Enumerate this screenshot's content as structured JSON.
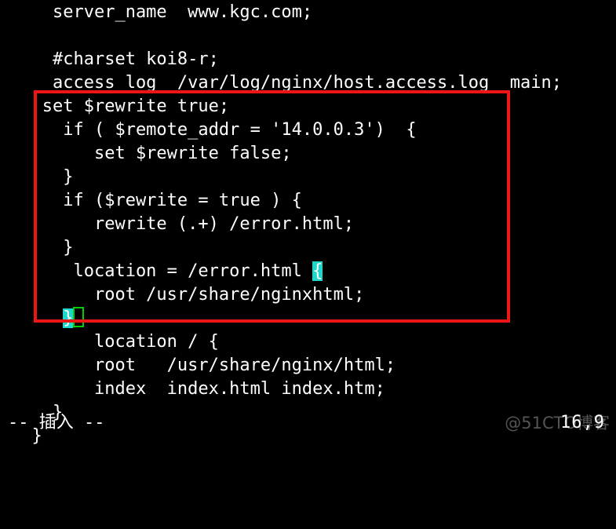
{
  "app": {
    "name": "vi-editor-terminal",
    "background_color": "#000000",
    "foreground_color": "#ffffff"
  },
  "colors": {
    "background": "#000000",
    "text": "#ffffff",
    "annotation_box": "#ee1515",
    "brace_match_highlight": "#1fd6cc",
    "cursor_outline": "#00d000",
    "watermark": "#9a9a9a"
  },
  "editor": {
    "lines": [
      {
        "text": "    server_name  www.kgc.com;",
        "id": "line-server-name"
      },
      {
        "text": "",
        "id": "line-blank-1"
      },
      {
        "text": "    #charset koi8-r;",
        "id": "line-charset"
      },
      {
        "text": "    access_log  /var/log/nginx/host.access.log  main;",
        "id": "line-access-log"
      },
      {
        "text": "   set $rewrite true;",
        "id": "line-set-rewrite-true"
      },
      {
        "text": "     if ( $remote_addr = '14.0.0.3')  {",
        "id": "line-if-remote-addr"
      },
      {
        "text": "        set $rewrite false;",
        "id": "line-set-rewrite-false"
      },
      {
        "text": "     }",
        "id": "line-close-if-1"
      },
      {
        "text": "     if ($rewrite = true ) {",
        "id": "line-if-rewrite-true"
      },
      {
        "text": "        rewrite (.+) /error.html;",
        "id": "line-rewrite-error"
      },
      {
        "text": "     }",
        "id": "line-close-if-2"
      },
      {
        "text": "      location = /error.html ",
        "id": "line-location-error",
        "brace": "{"
      },
      {
        "text": "        root /usr/share/nginxhtml;",
        "id": "line-root-nginxhtml"
      },
      {
        "text": "     ",
        "id": "line-close-location-error",
        "brace": "}",
        "cursor": true
      },
      {
        "text": "        location / {",
        "id": "line-location-root"
      },
      {
        "text": "        root   /usr/share/nginx/html;",
        "id": "line-root-html"
      },
      {
        "text": "        index  index.html index.htm;",
        "id": "line-index"
      },
      {
        "text": "    }",
        "id": "line-close-server"
      },
      {
        "text": "  }",
        "id": "line-close-http"
      }
    ]
  },
  "annotation": {
    "red_box_label": "highlighted-config-region"
  },
  "status": {
    "mode": "-- 插入 --",
    "position": "16,9"
  },
  "watermark": {
    "text": "@51CTO博客"
  }
}
